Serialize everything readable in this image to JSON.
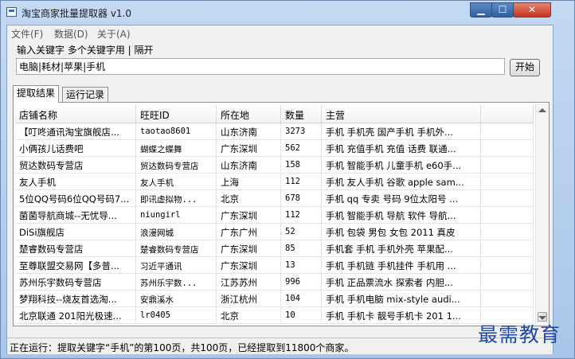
{
  "window": {
    "title": "淘宝商家批量提取器 v1.0",
    "min_icon": "minimize-icon",
    "max_icon": "maximize-icon",
    "close_icon": "close-icon"
  },
  "menu": [
    {
      "label": "文件(F)"
    },
    {
      "label": "数据(D)"
    },
    {
      "label": "关于(A)"
    }
  ],
  "search": {
    "prompt": "输入关键字 多个关键字用 | 隔开",
    "value": "电脑|耗材|苹果|手机",
    "start_label": "开始"
  },
  "tabs": [
    {
      "label": "提取结果"
    },
    {
      "label": "运行记录"
    }
  ],
  "table": {
    "columns": [
      "店铺名称",
      "旺旺ID",
      "所在地",
      "数量",
      "主营",
      ""
    ],
    "rows": [
      [
        "【叮咚通讯淘宝旗舰店...",
        "taotao8601",
        "山东济南",
        "3273",
        "手机 手机壳 国产手机 手机外...",
        ""
      ],
      [
        "小俩孩儿话费吧",
        "蝴蝶之蝶舞",
        "广东深圳",
        "562",
        "手机 充值手机 充值 话费 联通...",
        ""
      ],
      [
        "贸达数码专营店",
        "贸达数码专营店",
        "山东济南",
        "158",
        "手机 智能手机 儿童手机 e60手...",
        ""
      ],
      [
        "友人手机",
        "友人手机",
        "上海",
        "112",
        "手机 友人手机 谷歌 apple sam...",
        ""
      ],
      [
        "5位QQ号码6位QQ号码7...",
        "即讯虚拟物...",
        "北京",
        "678",
        "手机 qq 专卖 号码 9位太阳号 ...",
        ""
      ],
      [
        "菌菌导航商城--无忧导...",
        "niungirl",
        "广东深圳",
        "112",
        "手机 智能手机 导航 软件 导航...",
        ""
      ],
      [
        "DiSi旗舰店",
        "浪漫网城",
        "广东广州",
        "52",
        "手机 包袋 男包 女包 2011 真皮",
        ""
      ],
      [
        "楚睿数码专营店",
        "楚睿数码专营店",
        "广东深圳",
        "85",
        "手机套 手机 手机外壳 苹果配...",
        ""
      ],
      [
        "至尊联盟交易网【多普...",
        "习近平通讯",
        "广东深圳",
        "13",
        "手机 手机链 手机挂件 手机用 ...",
        ""
      ],
      [
        "苏州乐宇数码专营店",
        "苏州乐宇数...",
        "江苏苏州",
        "996",
        "手机 正品票流水 探索者 内胆...",
        ""
      ],
      [
        "梦翔科技--烧友首选淘...",
        "安鼎溪水",
        "浙江杭州",
        "104",
        "手机 手机电脑 mix-style audi...",
        ""
      ],
      [
        "北京联通 201阳光极速...",
        "lr0405",
        "北京",
        "10",
        "手机 手机卡 靓号手机卡 201 1...",
        ""
      ]
    ]
  },
  "status": {
    "text": "正在运行：提取关键字“手机”的第100页，共100页，已经提取到11800个商家。"
  },
  "watermark": "最需教育",
  "scrollbar": {
    "up_icon": "scroll-up-icon",
    "down_icon": "scroll-down-icon"
  }
}
